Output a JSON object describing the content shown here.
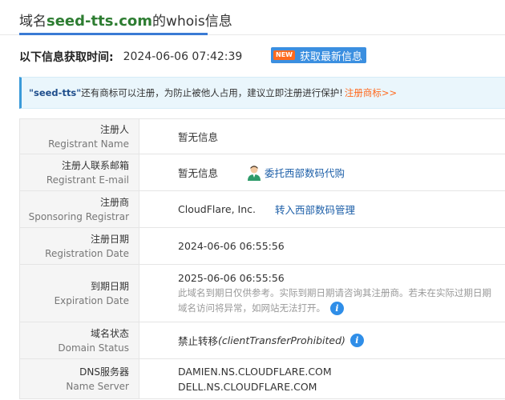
{
  "header": {
    "title_prefix": "域名",
    "title_domain": "seed-tts.com",
    "title_suffix": "的whois信息"
  },
  "fetch": {
    "label": "以下信息获取时间:",
    "time": "2024-06-06 07:42:39",
    "refresh_badge": "NEW",
    "refresh_label": "获取最新信息"
  },
  "notice": {
    "name": "\"seed-tts\"",
    "text": " 还有商标可以注册，为防止被他人占用，建议立即注册进行保护!",
    "link": "注册商标>>"
  },
  "rows": {
    "registrant": {
      "label_zh": "注册人",
      "label_en": "Registrant Name",
      "value": "暂无信息"
    },
    "email": {
      "label_zh": "注册人联系邮箱",
      "label_en": "Registrant E-mail",
      "value": "暂无信息",
      "link": "委托西部数码代购"
    },
    "registrar": {
      "label_zh": "注册商",
      "label_en": "Sponsoring Registrar",
      "value": "CloudFlare, Inc.",
      "link": "转入西部数码管理"
    },
    "reg_date": {
      "label_zh": "注册日期",
      "label_en": "Registration Date",
      "value": "2024-06-06 06:55:56"
    },
    "exp_date": {
      "label_zh": "到期日期",
      "label_en": "Expiration Date",
      "value": "2025-06-06 06:55:56",
      "note_line1": "此域名到期日仅供参考。实际到期日期请咨询其注册商。若未在实际过期日期",
      "note_line2": "域名访问将异常，如网站无法打开。"
    },
    "status": {
      "label_zh": "域名状态",
      "label_en": "Domain Status",
      "value_zh": "禁止转移",
      "value_en": "(clientTransferProhibited)"
    },
    "dns": {
      "label_zh": "DNS服务器",
      "label_en": "Name Server",
      "ns1": "DAMIEN.NS.CLOUDFLARE.COM",
      "ns2": "DELL.NS.CLOUDFLARE.COM"
    }
  },
  "icons": {
    "info": "info-icon",
    "person": "person-icon",
    "info_glyph": "i"
  },
  "colors": {
    "domain_green": "#2e7d32",
    "accent_blue": "#3b8fe0",
    "new_orange": "#ff6a1f",
    "link_blue": "#1d5fa8"
  }
}
